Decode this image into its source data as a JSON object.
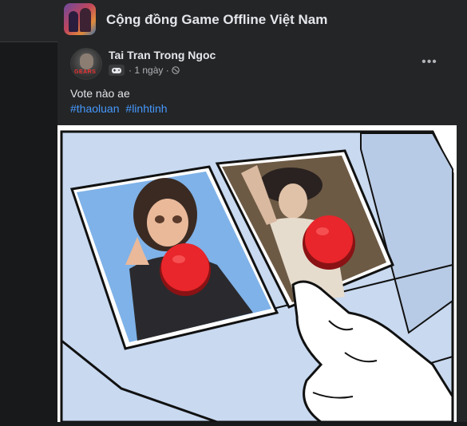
{
  "group": {
    "name": "Cộng đồng Game Offline Việt Nam",
    "avatar_icon": "group-avatar-image"
  },
  "post": {
    "author": "Tai Tran Trong Ngoc",
    "author_avatar_text": "GEARS",
    "badge_icon": "gamepad-icon",
    "time": "1 ngày",
    "separator": "·",
    "audience_icon": "globe-icon",
    "more_icon": "•••",
    "text": "Vote nào ae",
    "hashtags": [
      "#thaoluan",
      "#linhtinh"
    ],
    "image": {
      "description_icon": "two-buttons-meme-image",
      "button_color": "#e8262b",
      "panel_color": "#c8d9f0"
    }
  },
  "colors": {
    "page_bg": "#18191a",
    "card_bg": "#242526",
    "text_primary": "#e4e6eb",
    "text_secondary": "#b0b3b8",
    "link": "#4599ff"
  }
}
